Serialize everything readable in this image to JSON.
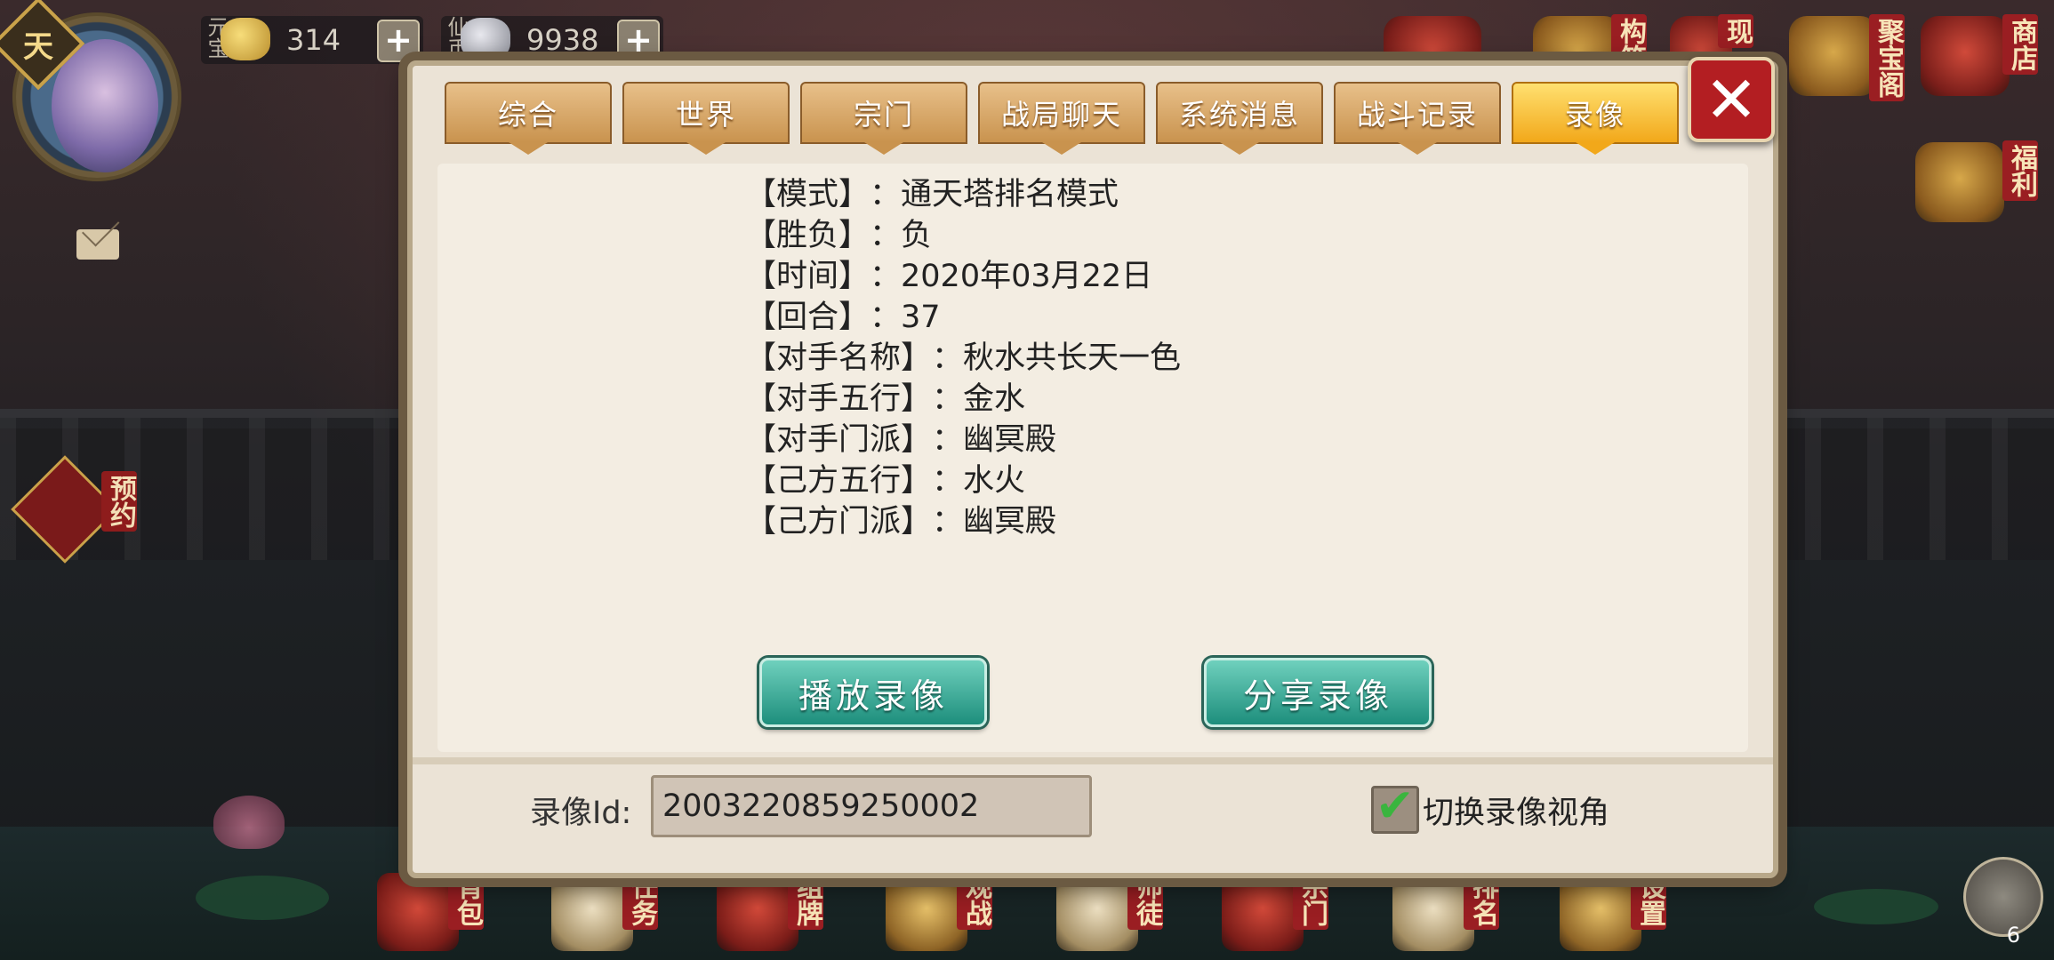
{
  "hud": {
    "avatar_badge": "天",
    "currencies": [
      {
        "label": "元宝",
        "amount": "314"
      },
      {
        "label": "仙币",
        "amount": "9938"
      }
    ],
    "plus": "+"
  },
  "left_buttons": [
    {
      "label": "预约"
    }
  ],
  "top_right_icons": [
    {
      "label": "构筑"
    },
    {
      "label": "现"
    },
    {
      "label": "聚宝阁"
    },
    {
      "label": "商店"
    },
    {
      "label": "福利"
    }
  ],
  "bottom_bar": [
    {
      "label": "背包"
    },
    {
      "label": "任务"
    },
    {
      "label": "组牌"
    },
    {
      "label": "观战"
    },
    {
      "label": "师徒"
    },
    {
      "label": "宗门"
    },
    {
      "label": "排名"
    },
    {
      "label": "设置"
    }
  ],
  "chat_count": "6",
  "dialog": {
    "tabs": [
      {
        "label": "综合",
        "active": false
      },
      {
        "label": "世界",
        "active": false
      },
      {
        "label": "宗门",
        "active": false
      },
      {
        "label": "战局聊天",
        "active": false
      },
      {
        "label": "系统消息",
        "active": false
      },
      {
        "label": "战斗记录",
        "active": false
      },
      {
        "label": "录像",
        "active": true
      }
    ],
    "close": "✕",
    "info": [
      {
        "key": "【模式】",
        "value": "：通天塔排名模式"
      },
      {
        "key": "【胜负】",
        "value": "：负"
      },
      {
        "key": "【时间】",
        "value": "：2020年03月22日"
      },
      {
        "key": "【回合】",
        "value": "：37"
      },
      {
        "key": "【对手名称】",
        "value": "：秋水共长天一色"
      },
      {
        "key": "【对手五行】",
        "value": "：金水"
      },
      {
        "key": "【对手门派】",
        "value": "：幽冥殿"
      },
      {
        "key": "【己方五行】",
        "value": "：水火"
      },
      {
        "key": "【己方门派】",
        "value": "：幽冥殿"
      }
    ],
    "play_button": "播放录像",
    "share_button": "分享录像",
    "id_label": "录像Id:",
    "id_value": "2003220859250002",
    "toggle_label": "切换录像视角",
    "toggle_checked": true
  }
}
